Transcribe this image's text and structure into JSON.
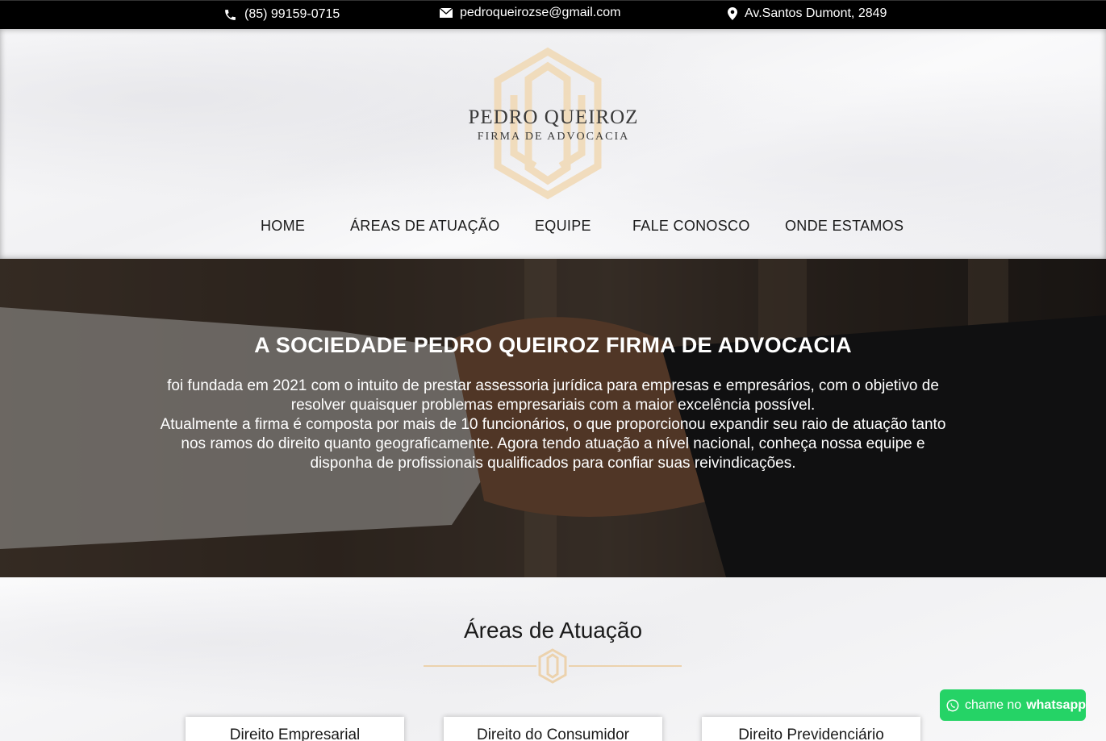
{
  "topbar": {
    "phone": "(85) 99159-0715",
    "email": "pedroqueirozse@gmail.com",
    "address": "Av.Santos Dumont, 2849"
  },
  "logo": {
    "title": "PEDRO QUEIROZ",
    "subtitle": "FIRMA DE ADVOCACIA"
  },
  "nav": {
    "items": [
      {
        "label": "HOME"
      },
      {
        "label": "ÁREAS DE ATUAÇÃO"
      },
      {
        "label": "EQUIPE"
      },
      {
        "label": "FALE CONOSCO"
      },
      {
        "label": "ONDE ESTAMOS"
      }
    ]
  },
  "hero": {
    "title": "A SOCIEDADE PEDRO QUEIROZ FIRMA DE ADVOCACIA",
    "paragraph1": "foi fundada em 2021 com o intuito de prestar assessoria jurídica para empresas e empresários, com o objetivo de resolver quaisquer problemas empresariais com a maior excelência possível.",
    "paragraph2": "Atualmente a firma é composta por mais de 10 funcionários, o que proporcionou expandir seu raio de atuação tanto nos ramos do direito quanto geograficamente. Agora tendo atuação a nível nacional, conheça nossa equipe e disponha de profissionais qualificados para confiar suas reivindicações."
  },
  "areas": {
    "heading": "Áreas de Atuação",
    "cards": [
      {
        "label": "Direito Empresarial"
      },
      {
        "label": "Direito do Consumidor"
      },
      {
        "label": "Direito Previdenciário"
      }
    ]
  },
  "whatsapp": {
    "prefix": "chame no",
    "brand": "whatsapp"
  },
  "colors": {
    "topbar_bg": "#000000",
    "gold": "#e8c999",
    "whatsapp_green": "#25d366"
  },
  "icons": [
    "phone-icon",
    "email-icon",
    "location-icon",
    "logo-mark-icon",
    "whatsapp-icon"
  ]
}
